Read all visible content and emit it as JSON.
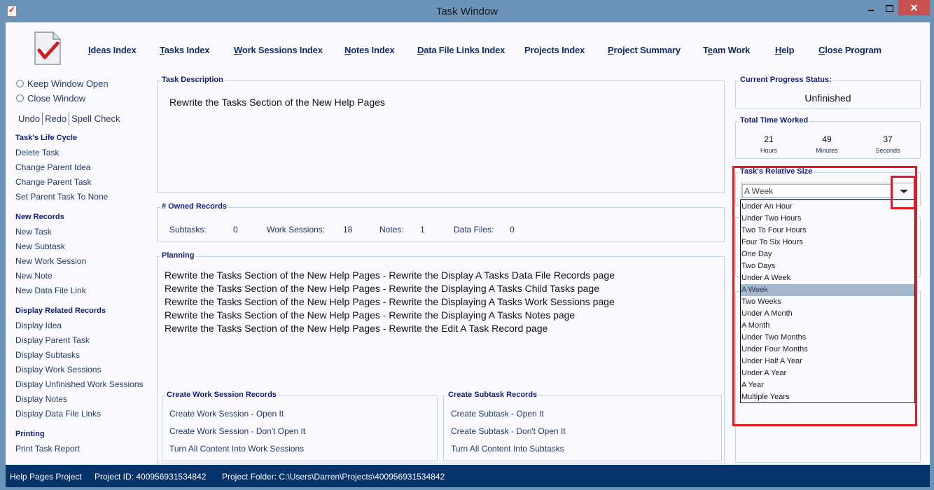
{
  "window": {
    "title": "Task Window",
    "controls": {
      "minimize": "minimize",
      "maximize": "maximize",
      "close": "✕"
    }
  },
  "nav": [
    {
      "label": "Ideas Index",
      "mnemonic": "I"
    },
    {
      "label": "Tasks Index",
      "mnemonic": "T"
    },
    {
      "label": "Work Sessions Index",
      "mnemonic": "W"
    },
    {
      "label": "Notes Index",
      "mnemonic": "N"
    },
    {
      "label": "Data File Links Index",
      "mnemonic": "D"
    },
    {
      "label": "Projects Index",
      "mnemonic": ""
    },
    {
      "label": "Project Summary",
      "mnemonic": "P"
    },
    {
      "label": "Team Work",
      "mnemonic": "e"
    },
    {
      "label": "Help",
      "mnemonic": "H"
    },
    {
      "label": "Close Program",
      "mnemonic": "C"
    }
  ],
  "sidebar": {
    "radios": [
      {
        "label": "Keep Window Open",
        "checked": false
      },
      {
        "label": "Close Window",
        "checked": false
      }
    ],
    "toolbar": [
      "Undo",
      "Redo",
      "Spell Check"
    ],
    "sections": [
      {
        "heading": "Task's Life Cycle",
        "items": [
          "Delete Task",
          "Change Parent Idea",
          "Change Parent Task",
          "Set Parent Task To None"
        ]
      },
      {
        "heading": "New Records",
        "items": [
          "New Task",
          "New Subtask",
          "New Work Session",
          "New Note",
          "New Data File Link"
        ]
      },
      {
        "heading": "Display Related Records",
        "items": [
          "Display Idea",
          "Display Parent Task",
          "Display Subtasks",
          "Display Work Sessions",
          "Display Unfinished Work Sessions",
          "Display Notes",
          "Display Data File Links"
        ]
      },
      {
        "heading": "Printing",
        "items": [
          "Print Task Report"
        ]
      }
    ]
  },
  "task_description": {
    "title": "Task Description",
    "text": "Rewrite the Tasks Section of the New Help Pages"
  },
  "owned_records": {
    "title": "# Owned Records",
    "fields": [
      {
        "label": "Subtasks:",
        "value": "0"
      },
      {
        "label": "Work Sessions:",
        "value": "18"
      },
      {
        "label": "Notes:",
        "value": "1"
      },
      {
        "label": "Data Files:",
        "value": "0"
      }
    ]
  },
  "planning": {
    "title": "Planning",
    "lines": [
      "Rewrite the Tasks Section of the New Help Pages - Rewrite the Display A Tasks Data File Records page",
      "Rewrite the Tasks Section of the New Help Pages - Rewrite the Displaying A Tasks Child Tasks page",
      "Rewrite the Tasks Section of the New Help Pages - Rewrite the Displaying A Tasks Work Sessions page",
      "Rewrite the Tasks Section of the New Help Pages - Rewrite the Displaying A Tasks Notes page",
      "Rewrite the Tasks Section of the New Help Pages - Rewrite the Edit A Task Record page"
    ]
  },
  "create_work_sessions": {
    "title": "Create Work Session Records",
    "actions": [
      "Create Work Session - Open It",
      "Create Work Session - Don't Open It",
      "Turn All Content Into Work Sessions"
    ]
  },
  "create_subtasks": {
    "title": "Create Subtask Records",
    "actions": [
      "Create Subtask - Open It",
      "Create Subtask - Don't Open It",
      "Turn All Content Into Subtasks"
    ]
  },
  "progress": {
    "title": "Current Progress Status:",
    "value": "Unfinished"
  },
  "time_worked": {
    "title": "Total Time Worked",
    "hours": "21",
    "hours_label": "Hours",
    "minutes": "49",
    "minutes_label": "Minutes",
    "seconds": "37",
    "seconds_label": "Seconds"
  },
  "relative_size": {
    "title": "Task's Relative Size",
    "value": "A Week",
    "options": [
      "Under An Hour",
      "Under Two Hours",
      "Two To Four Hours",
      "Four To Six Hours",
      "One Day",
      "Two Days",
      "Under A Week",
      "A Week",
      "Two Weeks",
      "Under A Month",
      "A Month",
      "Under Two Months",
      "Under Four Months",
      "Under Half A Year",
      "Under A Year",
      "A Year",
      "Multiple Years"
    ],
    "selected_index": 7
  },
  "statusbar": {
    "project": "Help Pages Project",
    "project_id": "Project ID:  400956931534842",
    "project_folder": "Project Folder: C:\\Users\\Darren\\Projects\\400956931534842"
  },
  "colors": {
    "highlight": "#e21b23",
    "statusbar_bg": "#06336a",
    "heading": "#0f1f7a",
    "link": "#1f3a6e",
    "selected_option": "#a4b7cd"
  }
}
